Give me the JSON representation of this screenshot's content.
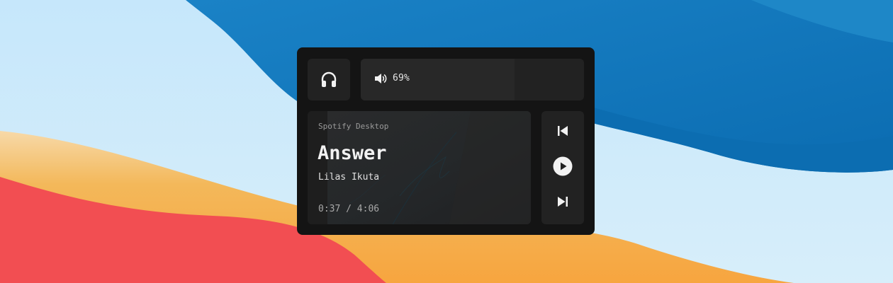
{
  "theme": {
    "widget_bg": "#141414",
    "panel_bg": "#222222",
    "icon_color": "#f2f2f2"
  },
  "output_device": {
    "icon": "headphones-icon"
  },
  "volume": {
    "icon": "speaker-icon",
    "level": 0.69,
    "label": "69%"
  },
  "player": {
    "app_name": "Spotify Desktop",
    "title": "Answer",
    "artist": "Lilas Ikuta",
    "time": "0:37 / 4:06"
  },
  "controls": {
    "previous_icon": "skip-previous-icon",
    "play_icon": "play-icon",
    "next_icon": "skip-next-icon"
  }
}
